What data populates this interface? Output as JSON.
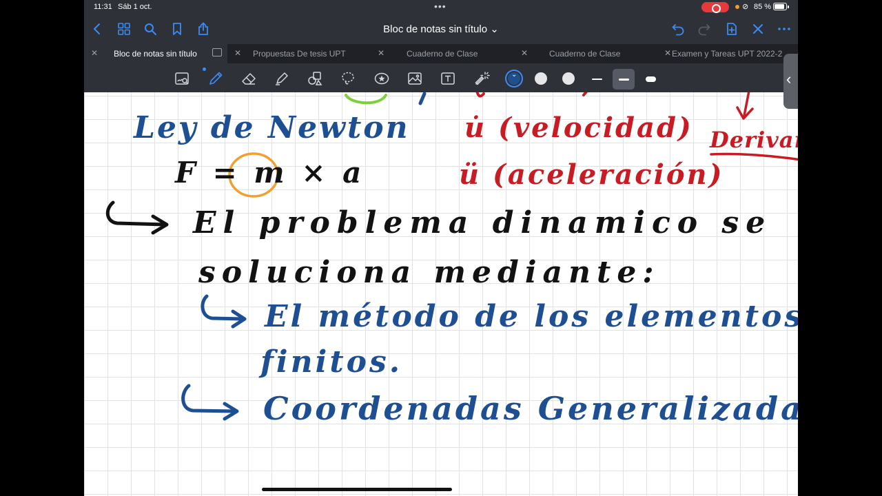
{
  "status_bar": {
    "time": "11:31",
    "date": "Sáb 1 oct.",
    "battery": "85 %"
  },
  "nav": {
    "title": "Bloc de notas sin título ⌄"
  },
  "tabs": [
    {
      "label": "Bloc de notas sin título",
      "active": true
    },
    {
      "label": "Propuestas De tesis UPT",
      "active": false
    },
    {
      "label": "Cuaderno de Clase",
      "active": false
    },
    {
      "label": "Cuaderno de Clase",
      "active": false
    },
    {
      "label": "Examen y Tareas UPT 2022-2",
      "active": false
    }
  ],
  "toolbar": {
    "selected_tool": "pen",
    "colors": [
      "#1f4f8f",
      "#e6e6e8",
      "#e6e6e8"
    ],
    "selected_stroke": 1
  },
  "notes": {
    "line1_left": "Ley de Newton",
    "line1_right": "u̇ (velocidad)",
    "line1_far_right": "Derivar",
    "line2_left": "F = m × a",
    "line2_right": "ü (aceleración)",
    "line3": "El problema dinamico se",
    "line4": "soluciona mediante:",
    "item1_line1": "El método de los elementos",
    "item1_line2": "finitos.",
    "item2": "Coordenadas Generalizadas."
  },
  "ink_colors": {
    "blue": "#1d4f92",
    "black": "#121212",
    "red": "#c81c24",
    "orange": "#f0a030",
    "green": "#7dd03a"
  }
}
